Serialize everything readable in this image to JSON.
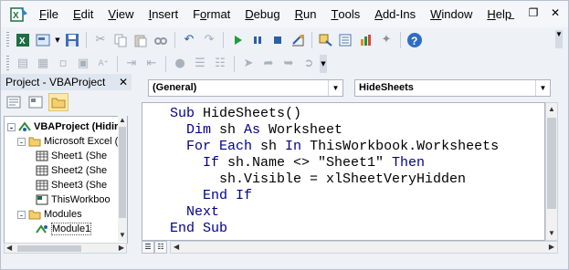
{
  "menu": {
    "items": [
      {
        "label": "File",
        "ul": "F",
        "rest": "ile"
      },
      {
        "label": "Edit",
        "ul": "E",
        "rest": "dit"
      },
      {
        "label": "View",
        "ul": "V",
        "rest": "iew"
      },
      {
        "label": "Insert",
        "ul": "I",
        "rest": "nsert"
      },
      {
        "label": "Format",
        "ul": "o",
        "pre": "F",
        "rest": "rmat"
      },
      {
        "label": "Debug",
        "ul": "D",
        "rest": "ebug"
      },
      {
        "label": "Run",
        "ul": "R",
        "rest": "un"
      },
      {
        "label": "Tools",
        "ul": "T",
        "rest": "ools"
      },
      {
        "label": "Add-Ins",
        "ul": "A",
        "rest": "dd-Ins"
      },
      {
        "label": "Window",
        "ul": "W",
        "rest": "indow"
      },
      {
        "label": "Help",
        "ul": "H",
        "rest": "elp"
      }
    ],
    "window_controls": [
      "minimize-icon",
      "restore-icon",
      "close-icon"
    ]
  },
  "project": {
    "title": "Project - VBAProject",
    "tree": [
      {
        "label": "VBAProject (Hidir",
        "icon": "vbaproject-icon"
      },
      {
        "label": "Microsoft Excel (",
        "icon": "folder-icon"
      },
      {
        "label": "Sheet1 (She",
        "icon": "sheet-icon"
      },
      {
        "label": "Sheet2 (She",
        "icon": "sheet-icon"
      },
      {
        "label": "Sheet3 (She",
        "icon": "sheet-icon"
      },
      {
        "label": "ThisWorkboo",
        "icon": "workbook-icon"
      },
      {
        "label": "Modules",
        "icon": "folder-icon"
      },
      {
        "label": "Module1",
        "icon": "module-icon"
      }
    ]
  },
  "code": {
    "object_dropdown": "(General)",
    "procedure_dropdown": "HideSheets",
    "lines": [
      [
        {
          "t": "Sub ",
          "k": true
        },
        {
          "t": "HideSheets()",
          "k": false
        }
      ],
      [
        {
          "t": "  Dim ",
          "k": true
        },
        {
          "t": "sh ",
          "k": false
        },
        {
          "t": "As ",
          "k": true
        },
        {
          "t": "Worksheet",
          "k": false
        }
      ],
      [
        {
          "t": "  For Each ",
          "k": true
        },
        {
          "t": "sh ",
          "k": false
        },
        {
          "t": "In ",
          "k": true
        },
        {
          "t": "ThisWorkbook.Worksheets",
          "k": false
        }
      ],
      [
        {
          "t": "    If ",
          "k": true
        },
        {
          "t": "sh.Name <> \"Sheet1\" ",
          "k": false
        },
        {
          "t": "Then",
          "k": true
        }
      ],
      [
        {
          "t": "      sh.Visible = xlSheetVeryHidden",
          "k": false
        }
      ],
      [
        {
          "t": "    End If",
          "k": true
        }
      ],
      [
        {
          "t": "  Next",
          "k": true
        }
      ],
      [
        {
          "t": "End Sub",
          "k": true
        }
      ]
    ]
  },
  "colors": {
    "keyword": "#00008b",
    "text": "#000000"
  }
}
